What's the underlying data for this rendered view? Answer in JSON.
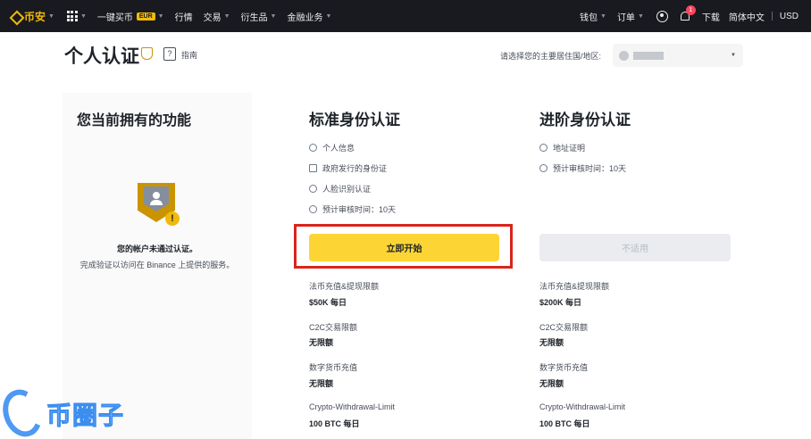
{
  "nav": {
    "logo": "币安",
    "buy_crypto": "一键买币",
    "currency_badge": "EUR",
    "markets": "行情",
    "trade": "交易",
    "derivatives": "衍生品",
    "finance": "金融业务",
    "wallet": "钱包",
    "orders": "订单",
    "notification_count": "1",
    "download": "下载",
    "language": "简体中文",
    "currency": "USD"
  },
  "header": {
    "title": "个人认证",
    "guide": "指南",
    "country_prompt": "请选择您的主要居住国/地区:"
  },
  "current": {
    "title": "您当前拥有的功能",
    "status": "您的帐户未通过认证。",
    "hint": "完成验证以访问在 Binance 上提供的服务。"
  },
  "standard": {
    "title": "标准身份认证",
    "requirements": [
      "个人信息",
      "政府发行的身份证",
      "人脸识别认证",
      "预计审核时间：10天"
    ],
    "button": "立即开始",
    "limits": [
      {
        "label": "法币充值&提现限额",
        "value": "$50K 每日"
      },
      {
        "label": "C2C交易限额",
        "value": "无限额"
      },
      {
        "label": "数字货币充值",
        "value": "无限额"
      },
      {
        "label": "Crypto-Withdrawal-Limit",
        "value": "100 BTC 每日"
      }
    ]
  },
  "advanced": {
    "title": "进阶身份认证",
    "requirements": [
      "地址证明",
      "预计审核时间：10天"
    ],
    "button": "不适用",
    "limits": [
      {
        "label": "法币充值&提现限额",
        "value": "$200K 每日"
      },
      {
        "label": "C2C交易限额",
        "value": "无限额"
      },
      {
        "label": "数字货币充值",
        "value": "无限额"
      },
      {
        "label": "Crypto-Withdrawal-Limit",
        "value": "100 BTC 每日"
      }
    ]
  },
  "watermark": "币圈子",
  "colors": {
    "nav_bg": "#181a20",
    "brand_yellow": "#f0b90b",
    "button_yellow": "#fcd535",
    "highlight_red": "#d9251c",
    "watermark_blue": "#3b8ef0"
  }
}
